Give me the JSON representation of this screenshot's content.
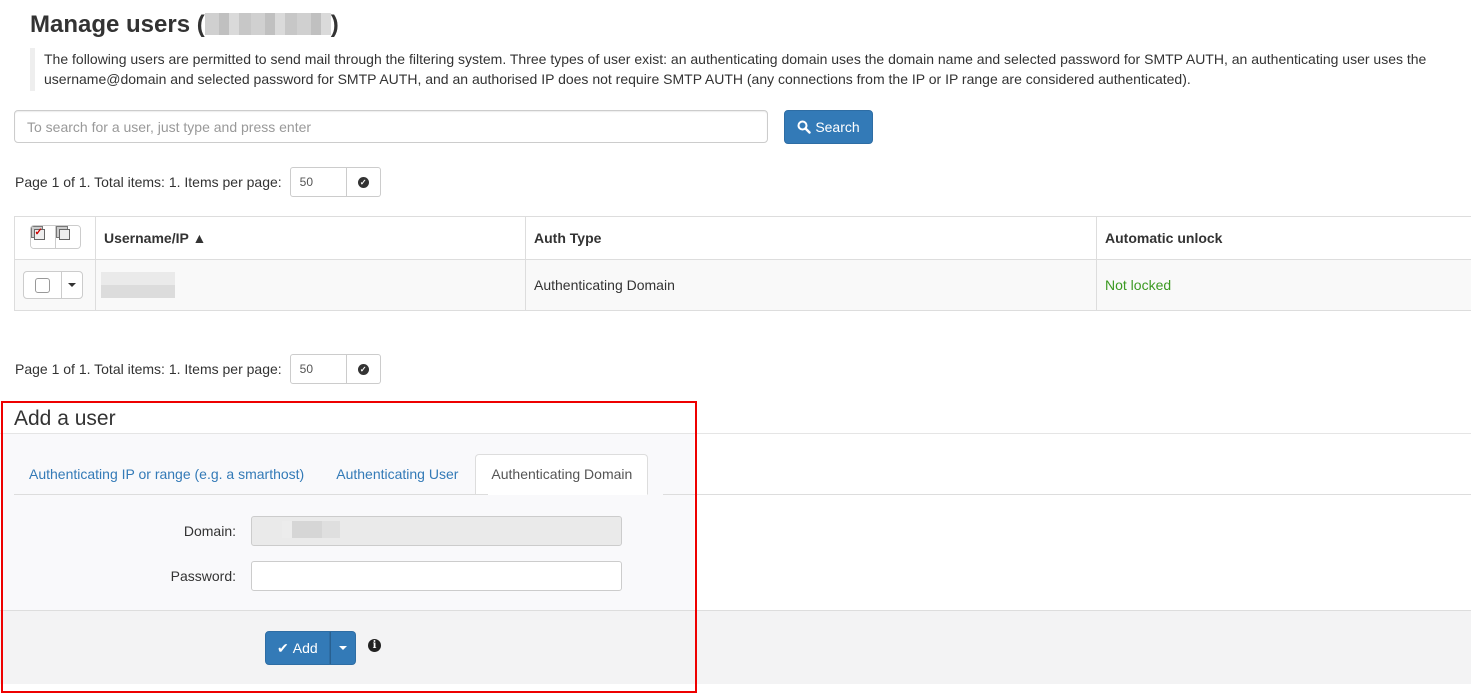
{
  "header": {
    "title": "Manage users (",
    "title_suffix": ")",
    "description": "The following users are permitted to send mail through the filtering system. Three types of user exist: an authenticating domain uses the domain name and selected password for SMTP AUTH, an authenticating user uses the username@domain and selected password for SMTP AUTH, and an authorised IP does not require SMTP AUTH (any connections from the IP or IP range are considered authenticated)."
  },
  "search": {
    "placeholder": "To search for a user, just type and press enter",
    "value": "",
    "button_label": "Search",
    "button_icon": "search-icon"
  },
  "pager_top": {
    "text": "Page 1 of 1. Total items: 1. Items per page:",
    "items_per_page": "50"
  },
  "pager_bottom": {
    "text": "Page 1 of 1. Total items: 1. Items per page:",
    "items_per_page": "50"
  },
  "table": {
    "columns": [
      "",
      "Username/IP ▲",
      "Auth Type",
      "Automatic unlock"
    ],
    "rows": [
      {
        "username": "",
        "auth_type": "Authenticating Domain",
        "unlock": "Not locked",
        "unlock_color": "#3c9a22"
      }
    ]
  },
  "add_user": {
    "title": "Add a user",
    "tabs": [
      {
        "label": "Authenticating IP or range (e.g. a smarthost)",
        "active": false
      },
      {
        "label": "Authenticating User",
        "active": false
      },
      {
        "label": "Authenticating Domain",
        "active": true
      }
    ],
    "fields": {
      "domain_label": "Domain:",
      "domain_value": "",
      "password_label": "Password:",
      "password_value": ""
    },
    "add_button_label": "Add"
  },
  "colors": {
    "primary": "#337ab7",
    "link": "#337ab7",
    "success": "#3c9a22",
    "highlight_border": "#e00000"
  }
}
